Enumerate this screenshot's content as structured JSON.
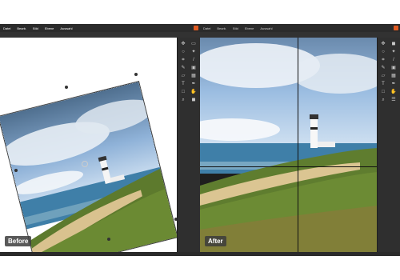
{
  "left_window": {
    "menu": [
      "Datei",
      "Bearb.",
      "Bild",
      "Ebene",
      "Auswahl"
    ],
    "labels": {
      "badge": "Before"
    }
  },
  "right_window": {
    "menu": [
      "Datei",
      "Bearb.",
      "Bild",
      "Ebene",
      "Auswahl"
    ],
    "labels": {
      "badge": "After"
    }
  },
  "colors": {
    "app_bg": "#3a3a3a",
    "close_button": "#e05a20",
    "sky": "#7aa6d6",
    "sea": "#3f7fa8",
    "grass": "#5d7a2d"
  }
}
